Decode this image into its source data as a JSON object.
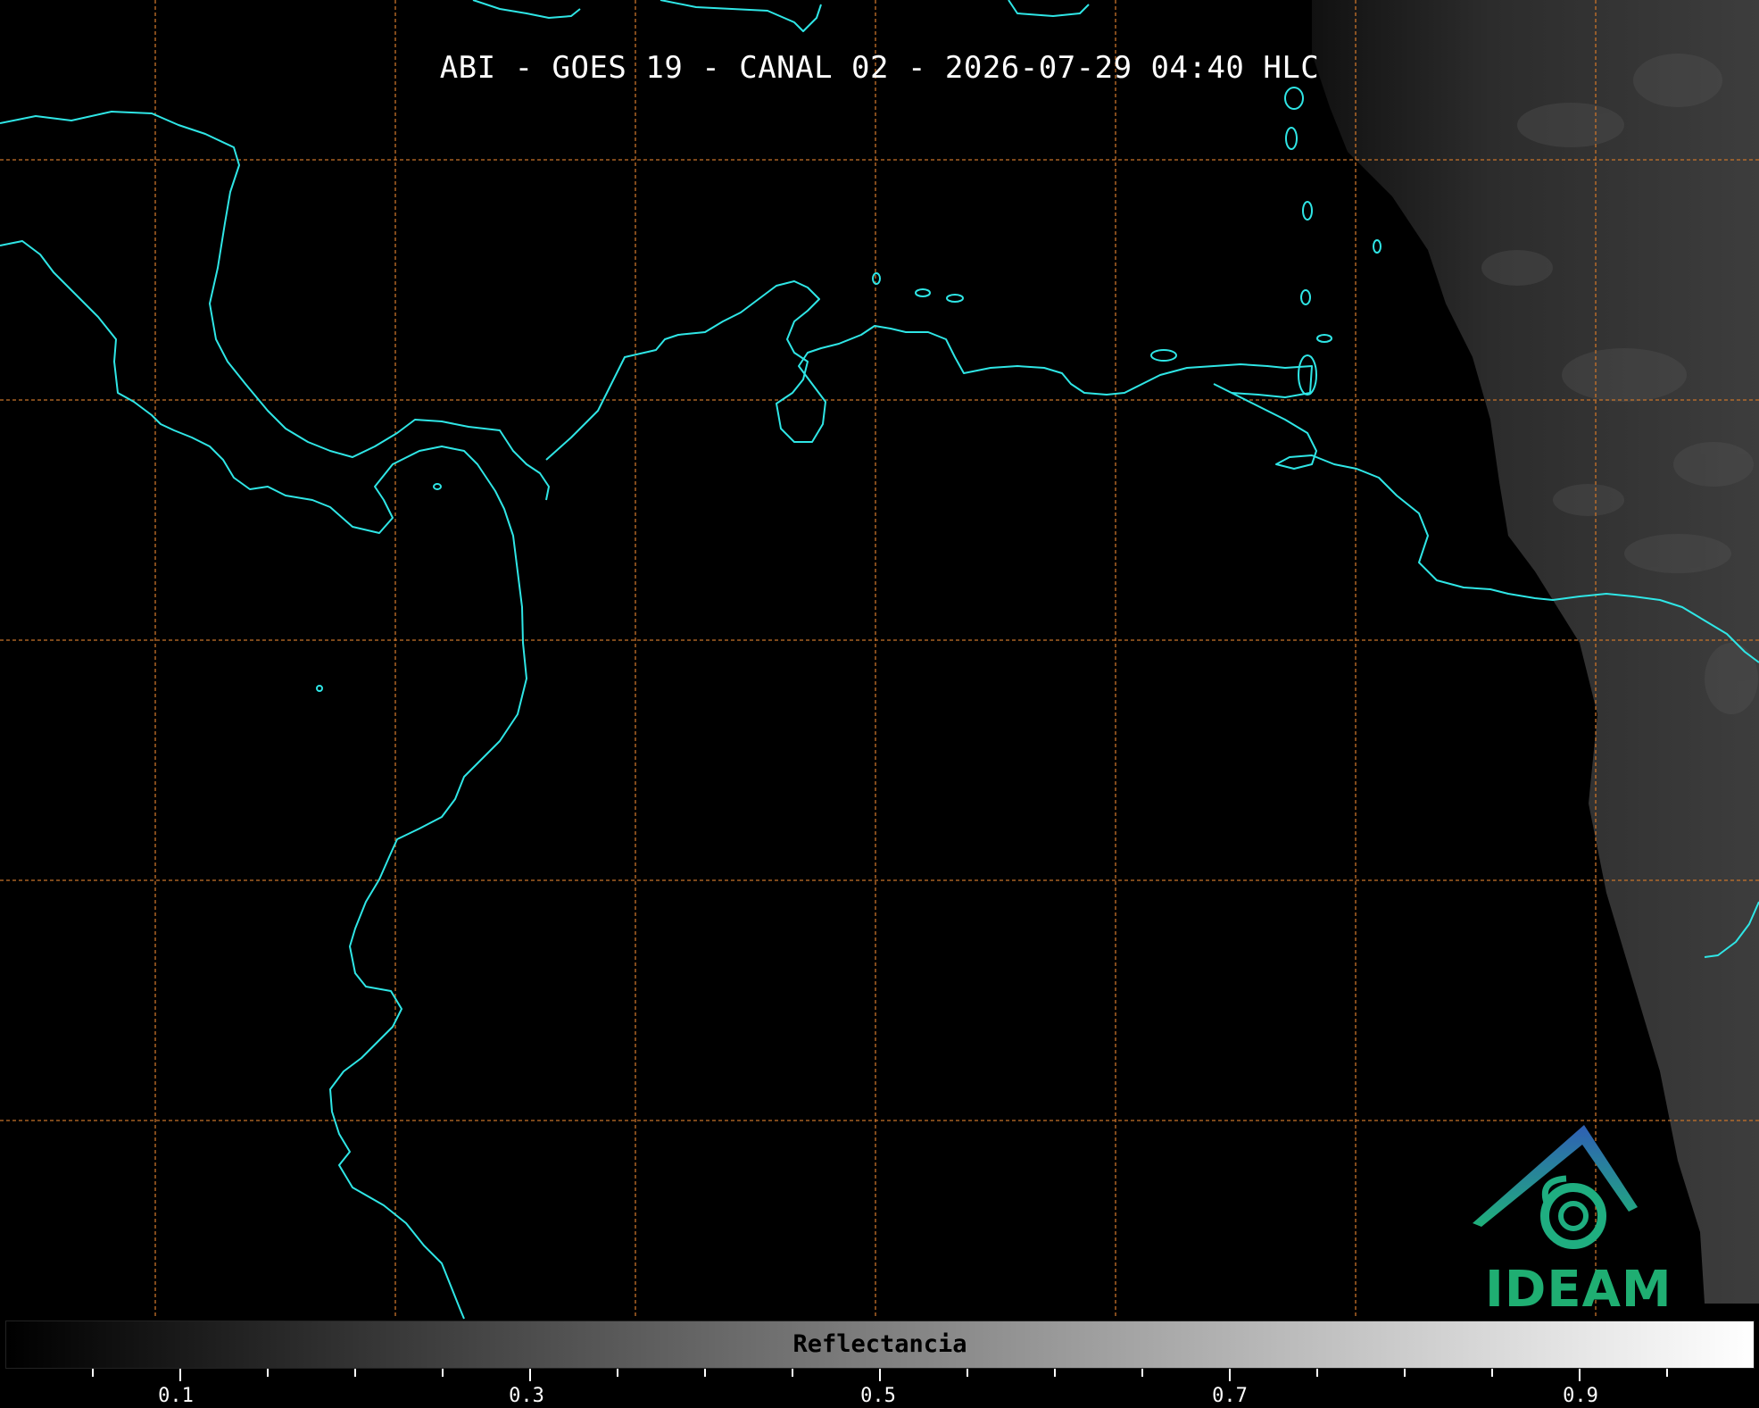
{
  "title": "ABI - GOES 19 - CANAL 02 - 2026-07-29 04:40 HLC",
  "colorbar": {
    "label": "Reflectancia",
    "range": [
      0.0,
      1.0
    ],
    "ticks": [
      "0.1",
      "0.3",
      "0.5",
      "0.7",
      "0.9"
    ],
    "colormap": "greyscale black to white"
  },
  "logo": {
    "text": "IDEAM"
  },
  "colors": {
    "coastline": "#2fe6e6",
    "graticule": "#c8732a",
    "background": "#000000",
    "logo_blue": "#2f6fb5",
    "logo_green": "#1fae72"
  }
}
